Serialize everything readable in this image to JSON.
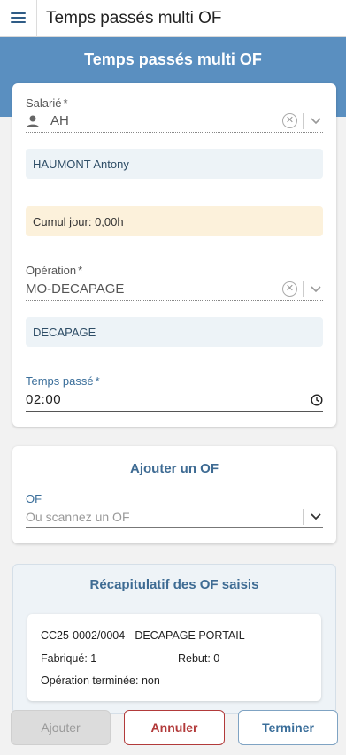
{
  "app": {
    "title": "Temps passés multi OF"
  },
  "header": {
    "title": "Temps passés multi OF"
  },
  "form": {
    "employee": {
      "label": "Salarié",
      "required_mark": "*",
      "value": "AH",
      "full_name": "HAUMONT Antony"
    },
    "daily_total": "Cumul jour: 0,00h",
    "operation": {
      "label": "Opération",
      "required_mark": "*",
      "value": "MO-DECAPAGE",
      "description": "DECAPAGE"
    },
    "time_spent": {
      "label": "Temps passé",
      "required_mark": "*",
      "value": "02:00"
    }
  },
  "add_of": {
    "title": "Ajouter un OF",
    "label": "OF",
    "placeholder": "Ou scannez un OF"
  },
  "recap": {
    "title": "Récapitulatif des OF saisis",
    "items": [
      {
        "title": "CC25-0002/0004 - DECAPAGE PORTAIL",
        "manufactured": "Fabriqué: 1",
        "scrap": "Rebut: 0",
        "operation_done": "Opération terminée: non"
      }
    ]
  },
  "buttons": {
    "add": "Ajouter",
    "cancel": "Annuler",
    "finish": "Terminer"
  },
  "icons": {
    "menu": "menu-icon",
    "user": "user-icon",
    "clear": "clear-circle-icon",
    "chevron": "chevron-down-icon",
    "clock": "clock-icon"
  },
  "colors": {
    "header_blue": "#5a8fc0",
    "accent_blue": "#3e6b93",
    "cancel_red": "#b23a3a",
    "warning_bg": "#fcf1db",
    "info_bg": "#edf3f7"
  }
}
